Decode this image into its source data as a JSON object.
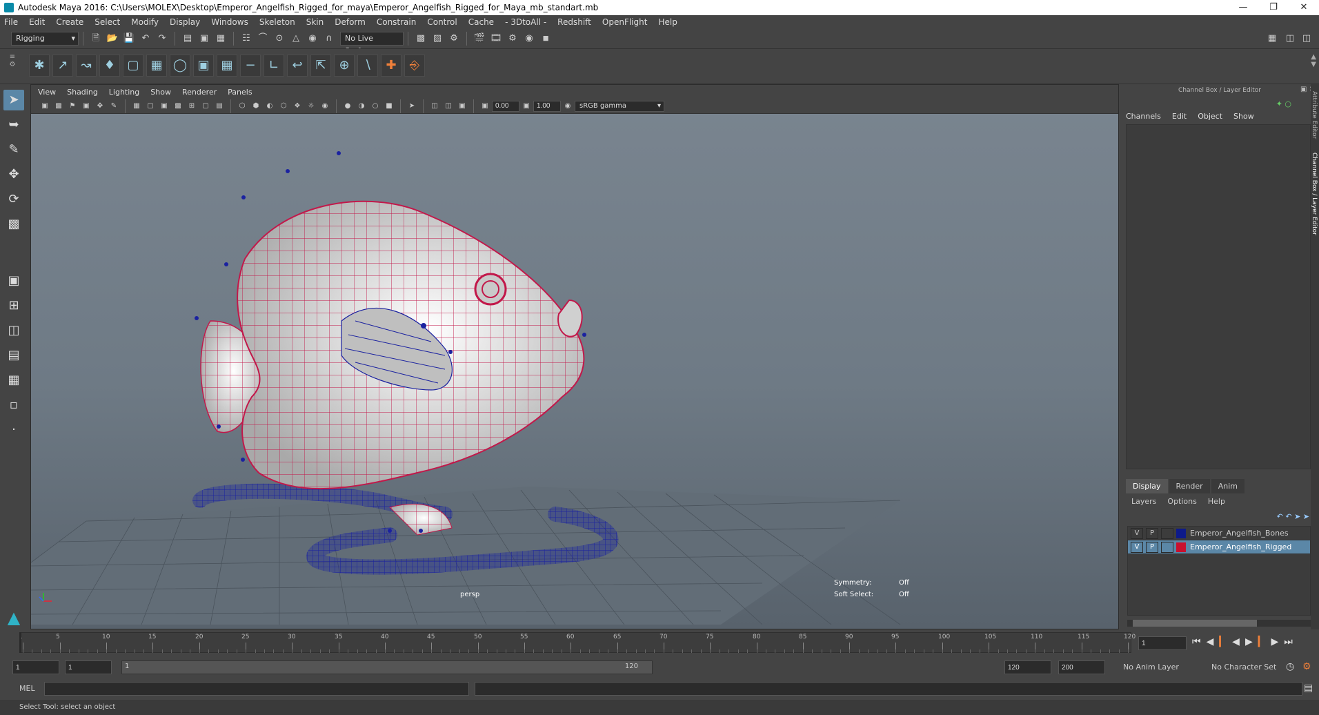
{
  "title": "Autodesk Maya 2016: C:\\Users\\MOLEX\\Desktop\\Emperor_Angelfish_Rigged_for_maya\\Emperor_Angelfish_Rigged_for_Maya_mb_standart.mb",
  "menu": [
    "File",
    "Edit",
    "Create",
    "Select",
    "Modify",
    "Display",
    "Windows",
    "Skeleton",
    "Skin",
    "Deform",
    "Constrain",
    "Control",
    "Cache",
    "- 3DtoAll -",
    "Redshift",
    "OpenFlight",
    "Help"
  ],
  "status": {
    "mode": "Rigging",
    "live_surface": "No Live Surface"
  },
  "viewport": {
    "menu": [
      "View",
      "Shading",
      "Lighting",
      "Show",
      "Renderer",
      "Panels"
    ],
    "exposure": "0.00",
    "gamma": "1.00",
    "colorspace": "sRGB gamma",
    "camera_label": "persp",
    "symmetry_label": "Symmetry:",
    "symmetry_value": "Off",
    "softselect_label": "Soft Select:",
    "softselect_value": "Off"
  },
  "channel_box": {
    "title": "Channel Box / Layer Editor",
    "menu": [
      "Channels",
      "Edit",
      "Object",
      "Show"
    ],
    "layer_tabs": [
      "Display",
      "Render",
      "Anim"
    ],
    "layer_menu": [
      "Layers",
      "Options",
      "Help"
    ],
    "layers": [
      {
        "v": "V",
        "p": "P",
        "color": "#0d1a8a",
        "name": "Emperor_Angelfish_Bones",
        "selected": false
      },
      {
        "v": "V",
        "p": "P",
        "color": "#c8102e",
        "name": "Emperor_Angelfish_Rigged",
        "selected": true
      }
    ],
    "side_tabs": [
      "Attribute Editor",
      "Channel Box / Layer Editor"
    ]
  },
  "timeline": {
    "ticks": [
      "1",
      "5",
      "10",
      "15",
      "20",
      "25",
      "30",
      "35",
      "40",
      "45",
      "50",
      "55",
      "60",
      "65",
      "70",
      "75",
      "80",
      "85",
      "90",
      "95",
      "100",
      "105",
      "110",
      "115",
      "120"
    ],
    "current_frame": "1"
  },
  "range": {
    "start": "1",
    "start2": "1",
    "slider_start": "1",
    "slider_end": "120",
    "end": "120",
    "end2": "200",
    "anim_layer": "No Anim Layer",
    "char_set": "No Character Set"
  },
  "cmd": {
    "label": "MEL"
  },
  "help_text": "Select Tool: select an object"
}
